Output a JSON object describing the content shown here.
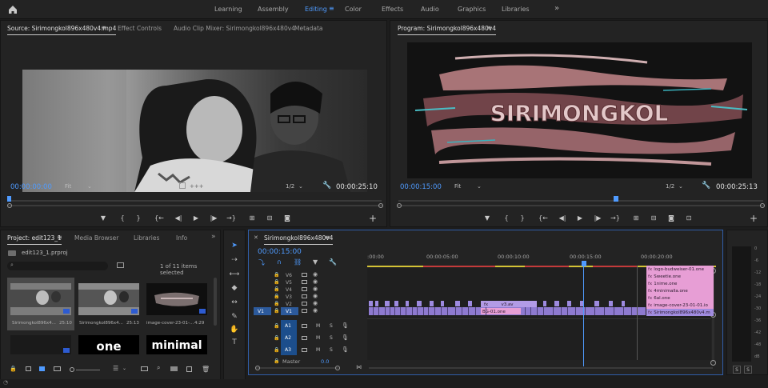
{
  "workspaces": [
    "Learning",
    "Assembly",
    "Editing",
    "Color",
    "Effects",
    "Audio",
    "Graphics",
    "Libraries"
  ],
  "workspace_active": "Editing",
  "workspace_more": "»",
  "source_panel": {
    "tabs": [
      "Source: Sirimongkol896x480v4.mp4",
      "Effect Controls",
      "Audio Clip Mixer: Sirimongkol896x480v4",
      "Metadata"
    ],
    "timecode_current": "00:00:00:00",
    "fit": "Fit",
    "resolution": "1/2",
    "timecode_duration": "00:00:25:10",
    "playhead_fraction": 0.0
  },
  "program_panel": {
    "title": "Program: Sirimongkol896x480v4",
    "timecode_current": "00:00:15:00",
    "fit": "Fit",
    "resolution": "1/2",
    "timecode_duration": "00:00:25:13",
    "video_text": "SIRIMONGKOL",
    "playhead_fraction": 0.59
  },
  "transport_glyphs": [
    "▼",
    "{",
    "}",
    "{←",
    "◀|",
    "▶",
    "|▶",
    "→}",
    "⊞",
    "⊟",
    "📷",
    "+"
  ],
  "project_panel": {
    "tabs": [
      "Project: edit123_1",
      "Media Browser",
      "Libraries",
      "Info"
    ],
    "more": "»",
    "file": "edit123_1.prproj",
    "items_count": "1 of 11 items selected",
    "items": [
      {
        "name": "Sirimongkol896x4...",
        "duration": "25:10"
      },
      {
        "name": "Sirimongkol896x4...",
        "duration": "25:13"
      },
      {
        "name": "image-cover-23-01-...",
        "duration": "4:29"
      },
      {
        "name": "",
        "duration": ""
      },
      {
        "name": "one",
        "duration": ""
      },
      {
        "name": "minimal",
        "duration": ""
      }
    ]
  },
  "timeline": {
    "tab": "Sirimongkol896x480v4",
    "timecode": "00:00:15:00",
    "ruler": [
      ":00:00",
      "00:00:05:00",
      "00:00:10:00",
      "00:00:15:00",
      "00:00:20:00"
    ],
    "video_tracks": [
      "V6",
      "V5",
      "V4",
      "V3",
      "V2",
      "V1"
    ],
    "audio_tracks": [
      "A1",
      "A2",
      "A3"
    ],
    "master_label": "Master",
    "master_value": "0.0",
    "source_patch_v": "V1",
    "audio_letters": [
      "M",
      "S"
    ],
    "clips_right": [
      "logo-budweiser-01.one",
      "Sweetie.one",
      "1nime.one",
      "4minimalla.one",
      "6al.one",
      "image-cover-23-01-01.io",
      "Sirimongkol896x480v4.m"
    ],
    "clip_bg": "BG-01.one",
    "clip_v3": "v3.av",
    "fx": "fx"
  },
  "meter_labels": [
    "0",
    "-6",
    "-12",
    "-18",
    "-24",
    "-30",
    "-36",
    "-42",
    "-48",
    "dB"
  ],
  "meter_solo": [
    "S",
    "S"
  ],
  "colors": {
    "accent": "#4f9bff",
    "pink_clip": "#e79ed5",
    "purple_clip": "#a18ce0",
    "yellow_bar": "#d4c235",
    "red_bar": "#c43a3a"
  }
}
